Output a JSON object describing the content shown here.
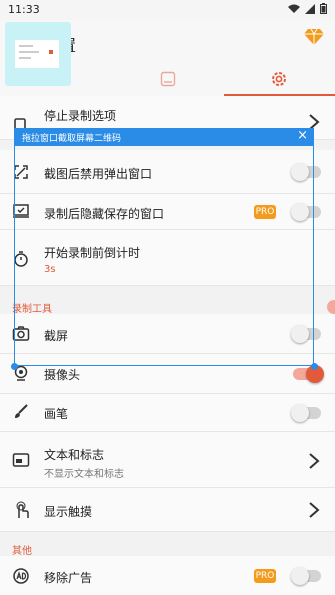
{
  "status_bar": {
    "time": "11:33"
  },
  "app_bar": {
    "title": "置"
  },
  "overlay": {
    "text": "拖拉窗口截取屏幕二维码",
    "close": "×"
  },
  "rows": {
    "stop_options": "停止录制选项",
    "disable_popup": "截图后禁用弹出窗口",
    "hide_saved": "录制后隐藏保存的窗口",
    "countdown": "开始录制前倒计时",
    "countdown_value": "3s",
    "screenshot": "截屏",
    "camera": "摄像头",
    "brush": "画笔",
    "text_logo": "文本和标志",
    "text_logo_sub": "不显示文本和标志",
    "show_touches": "显示触摸",
    "remove_ads": "移除广告"
  },
  "sections": {
    "record_tools": "录制工具",
    "other": "其他"
  },
  "badges": {
    "pro": "PRO"
  },
  "colors": {
    "accent": "#e35a3a",
    "overlay_blue": "#2a8ce6",
    "pro_orange": "#f29b1d"
  }
}
